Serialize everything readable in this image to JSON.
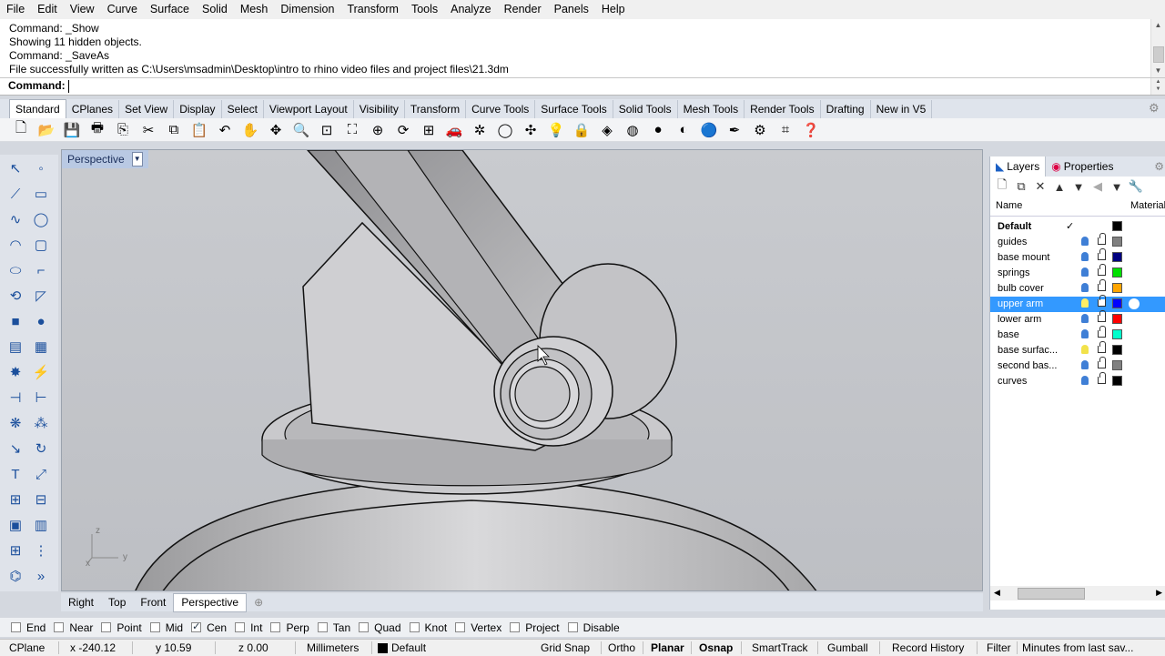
{
  "menu": [
    "File",
    "Edit",
    "View",
    "Curve",
    "Surface",
    "Solid",
    "Mesh",
    "Dimension",
    "Transform",
    "Tools",
    "Analyze",
    "Render",
    "Panels",
    "Help"
  ],
  "command_history": [
    "Command: _Show",
    "Showing 11 hidden objects.",
    "Command: _SaveAs",
    "File successfully written as C:\\Users\\msadmin\\Desktop\\intro to rhino video files and project files\\21.3dm"
  ],
  "command_prompt": "Command:",
  "toolbar_tabs": [
    "Standard",
    "CPlanes",
    "Set View",
    "Display",
    "Select",
    "Viewport Layout",
    "Visibility",
    "Transform",
    "Curve Tools",
    "Surface Tools",
    "Solid Tools",
    "Mesh Tools",
    "Render Tools",
    "Drafting",
    "New in V5"
  ],
  "toolbar_icons": [
    "new-file-icon",
    "open-file-icon",
    "save-icon",
    "print-icon",
    "export-icon",
    "cut-icon",
    "copy-icon",
    "paste-icon",
    "undo-icon",
    "pan-icon",
    "move-view-icon",
    "zoom-icon",
    "zoom-window-icon",
    "zoom-extents-icon",
    "zoom-selected-icon",
    "rotate-view-icon",
    "four-viewports-icon",
    "car-icon",
    "gear-pan-icon",
    "circle-icon",
    "point-icon",
    "light-bulb-icon",
    "lock-icon",
    "layer-icon",
    "color-wheel-icon",
    "sphere-icon",
    "shaded-sphere-icon",
    "render-sphere-icon",
    "pen-icon",
    "settings-gear-icon",
    "grid-icon",
    "help-icon"
  ],
  "viewport": {
    "title": "Perspective"
  },
  "view_tabs": [
    "Right",
    "Top",
    "Front",
    "Perspective"
  ],
  "panel": {
    "tabs": [
      "Layers",
      "Properties"
    ],
    "col_name": "Name",
    "col_material": "Material",
    "layers": [
      {
        "name": "Default",
        "color": "#000000",
        "current": true,
        "selected": false,
        "bulb": "#3f7fd6"
      },
      {
        "name": "guides",
        "color": "#808080",
        "current": false,
        "selected": false,
        "bulb": "#3f7fd6"
      },
      {
        "name": "base mount",
        "color": "#000080",
        "current": false,
        "selected": false,
        "bulb": "#3f7fd6"
      },
      {
        "name": "springs",
        "color": "#00e000",
        "current": false,
        "selected": false,
        "bulb": "#3f7fd6"
      },
      {
        "name": "bulb cover",
        "color": "#ffa500",
        "current": false,
        "selected": false,
        "bulb": "#3f7fd6"
      },
      {
        "name": "upper arm",
        "color": "#0000ff",
        "current": false,
        "selected": true,
        "bulb": "#ffee66"
      },
      {
        "name": "lower arm",
        "color": "#ff0000",
        "current": false,
        "selected": false,
        "bulb": "#3f7fd6"
      },
      {
        "name": "base",
        "color": "#00ffcc",
        "current": false,
        "selected": false,
        "bulb": "#3f7fd6"
      },
      {
        "name": "base surfac...",
        "color": "#000000",
        "current": false,
        "selected": false,
        "bulb": "#f2e24a"
      },
      {
        "name": "second bas...",
        "color": "#808080",
        "current": false,
        "selected": false,
        "bulb": "#3f7fd6"
      },
      {
        "name": "curves",
        "color": "#000000",
        "current": false,
        "selected": false,
        "bulb": "#3f7fd6"
      }
    ],
    "current_mark": "✓"
  },
  "osnap": [
    {
      "label": "End",
      "checked": false
    },
    {
      "label": "Near",
      "checked": false
    },
    {
      "label": "Point",
      "checked": false
    },
    {
      "label": "Mid",
      "checked": false
    },
    {
      "label": "Cen",
      "checked": true
    },
    {
      "label": "Int",
      "checked": false
    },
    {
      "label": "Perp",
      "checked": false
    },
    {
      "label": "Tan",
      "checked": false
    },
    {
      "label": "Quad",
      "checked": false
    },
    {
      "label": "Knot",
      "checked": false
    },
    {
      "label": "Vertex",
      "checked": false
    },
    {
      "label": "Project",
      "checked": false
    },
    {
      "label": "Disable",
      "checked": false
    }
  ],
  "status": {
    "cplane": "CPlane",
    "x": "x -240.12",
    "y": "y 10.59",
    "z": "z 0.00",
    "units": "Millimeters",
    "layer": "Default",
    "grid_snap": "Grid Snap",
    "ortho": "Ortho",
    "planar": "Planar",
    "osnap": "Osnap",
    "smarttrack": "SmartTrack",
    "gumball": "Gumball",
    "record_history": "Record History",
    "filter": "Filter",
    "minutes": "Minutes from last sav..."
  },
  "axis": {
    "x": "x",
    "y": "y",
    "z": "z"
  }
}
